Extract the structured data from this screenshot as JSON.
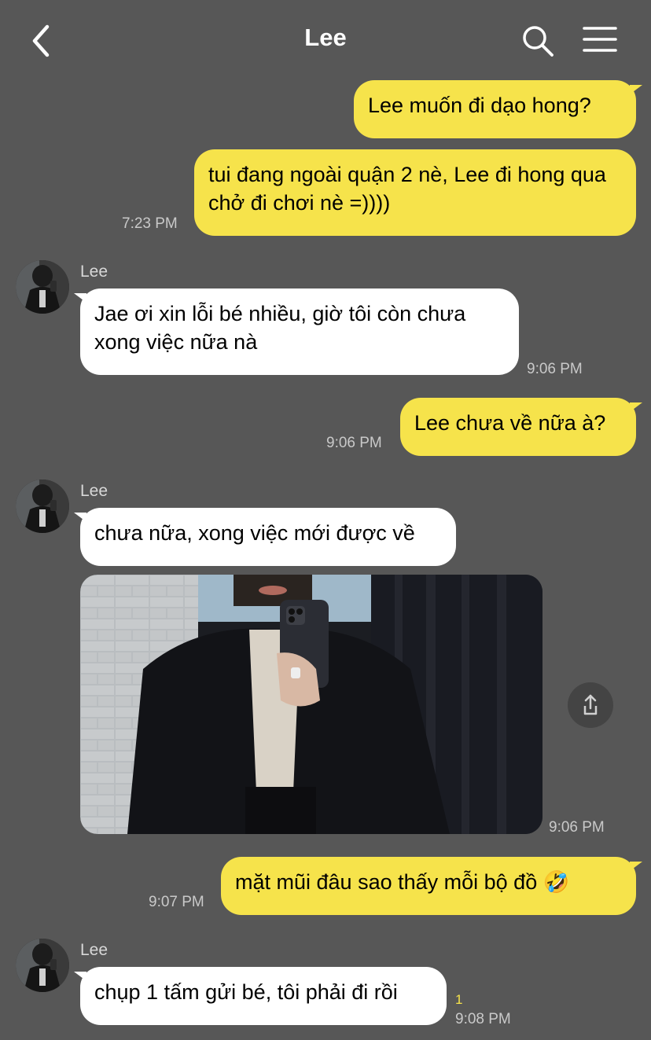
{
  "header": {
    "title": "Lee",
    "back_icon": "chevron-left-icon",
    "search_icon": "search-icon",
    "menu_icon": "menu-icon"
  },
  "colors": {
    "background": "#575757",
    "my_bubble": "#f6e34b",
    "their_bubble": "#ffffff",
    "timestamp": "#c9c9c9"
  },
  "messages": [
    {
      "from": "me",
      "text": "Lee muốn đi dạo hong?",
      "time": ""
    },
    {
      "from": "me",
      "text": "tui đang ngoài quận 2 nè, Lee đi hong qua chở đi chơi nè =))))",
      "time": "7:23 PM"
    },
    {
      "from": "Lee",
      "sender": "Lee",
      "text": "Jae ơi xin lỗi bé nhiều, giờ tôi còn chưa xong việc nữa nà",
      "time": "9:06 PM"
    },
    {
      "from": "me",
      "text": "Lee chưa về nữa à?",
      "time": "9:06 PM"
    },
    {
      "from": "Lee",
      "sender": "Lee",
      "text": "chưa nữa, xong việc mới được về",
      "time": ""
    },
    {
      "from": "Lee",
      "type": "photo",
      "time": "9:06 PM",
      "share_icon": "share-icon"
    },
    {
      "from": "me",
      "text": "mặt mũi đâu sao thấy mỗi bộ đồ 🤣",
      "time": "9:07 PM"
    },
    {
      "from": "Lee",
      "sender": "Lee",
      "text": "chụp 1 tấm gửi bé, tôi phải đi rồi",
      "time": "9:08 PM",
      "unread": "1"
    }
  ]
}
